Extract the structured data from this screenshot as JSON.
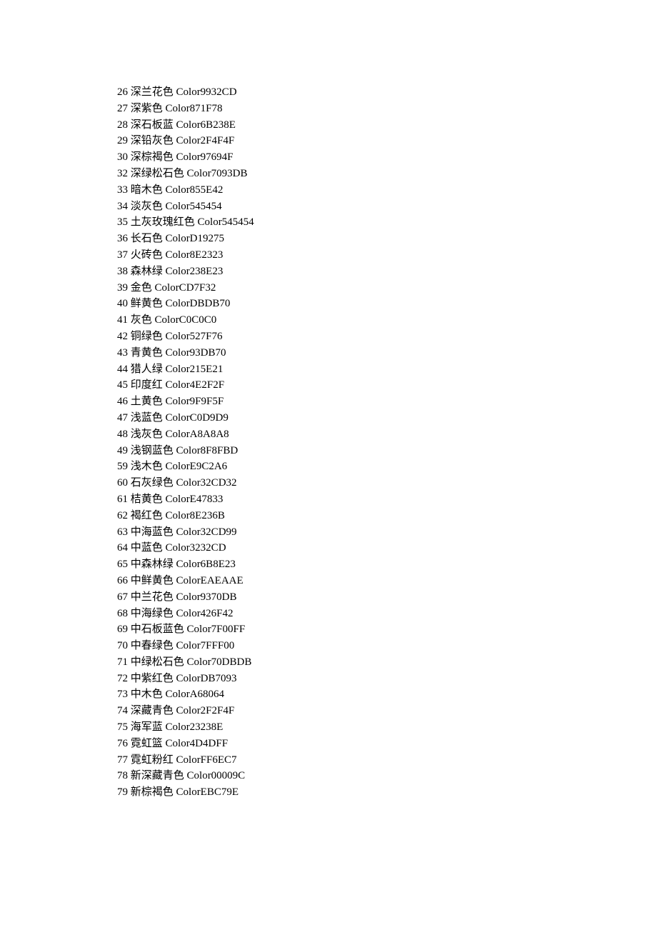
{
  "colors": [
    {
      "num": "26",
      "name": "深兰花色",
      "code": "Color9932CD"
    },
    {
      "num": "27",
      "name": "深紫色",
      "code": "Color871F78"
    },
    {
      "num": "28",
      "name": "深石板蓝",
      "code": "Color6B238E"
    },
    {
      "num": "29",
      "name": "深铅灰色",
      "code": "Color2F4F4F"
    },
    {
      "num": "30",
      "name": "深棕褐色",
      "code": "Color97694F"
    },
    {
      "num": "32",
      "name": "深绿松石色",
      "code": "Color7093DB"
    },
    {
      "num": "33",
      "name": "暗木色",
      "code": "Color855E42"
    },
    {
      "num": "34",
      "name": "淡灰色",
      "code": "Color545454"
    },
    {
      "num": "35",
      "name": "土灰玫瑰红色",
      "code": "Color545454"
    },
    {
      "num": "36",
      "name": "长石色",
      "code": "ColorD19275"
    },
    {
      "num": "37",
      "name": "火砖色",
      "code": "Color8E2323"
    },
    {
      "num": "38",
      "name": "森林绿",
      "code": "Color238E23"
    },
    {
      "num": "39",
      "name": "金色",
      "code": "ColorCD7F32"
    },
    {
      "num": "40",
      "name": "鲜黄色",
      "code": "ColorDBDB70"
    },
    {
      "num": "41",
      "name": "灰色",
      "code": "ColorC0C0C0"
    },
    {
      "num": "42",
      "name": "铜绿色",
      "code": "Color527F76"
    },
    {
      "num": "43",
      "name": "青黄色",
      "code": "Color93DB70"
    },
    {
      "num": "44",
      "name": "猎人绿",
      "code": "Color215E21"
    },
    {
      "num": "45",
      "name": "印度红",
      "code": "Color4E2F2F"
    },
    {
      "num": "46",
      "name": "土黄色",
      "code": "Color9F9F5F"
    },
    {
      "num": "47",
      "name": "浅蓝色",
      "code": "ColorC0D9D9"
    },
    {
      "num": "48",
      "name": "浅灰色",
      "code": "ColorA8A8A8"
    },
    {
      "num": "49",
      "name": "浅钢蓝色",
      "code": "Color8F8FBD"
    },
    {
      "num": "59",
      "name": "浅木色",
      "code": "ColorE9C2A6"
    },
    {
      "num": "60",
      "name": "石灰绿色",
      "code": "Color32CD32"
    },
    {
      "num": "61",
      "name": "桔黄色",
      "code": "ColorE47833"
    },
    {
      "num": "62",
      "name": "褐红色",
      "code": "Color8E236B"
    },
    {
      "num": "63",
      "name": "中海蓝色",
      "code": "Color32CD99"
    },
    {
      "num": "64",
      "name": "中蓝色",
      "code": "Color3232CD"
    },
    {
      "num": "65",
      "name": "中森林绿",
      "code": "Color6B8E23"
    },
    {
      "num": "66",
      "name": "中鲜黄色",
      "code": "ColorEAEAAE"
    },
    {
      "num": "67",
      "name": "中兰花色",
      "code": "Color9370DB"
    },
    {
      "num": "68",
      "name": "中海绿色",
      "code": "Color426F42"
    },
    {
      "num": "69",
      "name": "中石板蓝色",
      "code": "Color7F00FF"
    },
    {
      "num": "70",
      "name": "中春绿色",
      "code": "Color7FFF00"
    },
    {
      "num": "71",
      "name": "中绿松石色",
      "code": "Color70DBDB"
    },
    {
      "num": "72",
      "name": "中紫红色",
      "code": "ColorDB7093"
    },
    {
      "num": "73",
      "name": "中木色",
      "code": "ColorA68064"
    },
    {
      "num": "74",
      "name": "深藏青色",
      "code": "Color2F2F4F"
    },
    {
      "num": "75",
      "name": "海军蓝",
      "code": "Color23238E"
    },
    {
      "num": "76",
      "name": "霓虹篮",
      "code": "Color4D4DFF"
    },
    {
      "num": "77",
      "name": "霓虹粉红",
      "code": "ColorFF6EC7"
    },
    {
      "num": "78",
      "name": "新深藏青色",
      "code": "Color00009C"
    },
    {
      "num": "79",
      "name": "新棕褐色",
      "code": "ColorEBC79E"
    }
  ]
}
